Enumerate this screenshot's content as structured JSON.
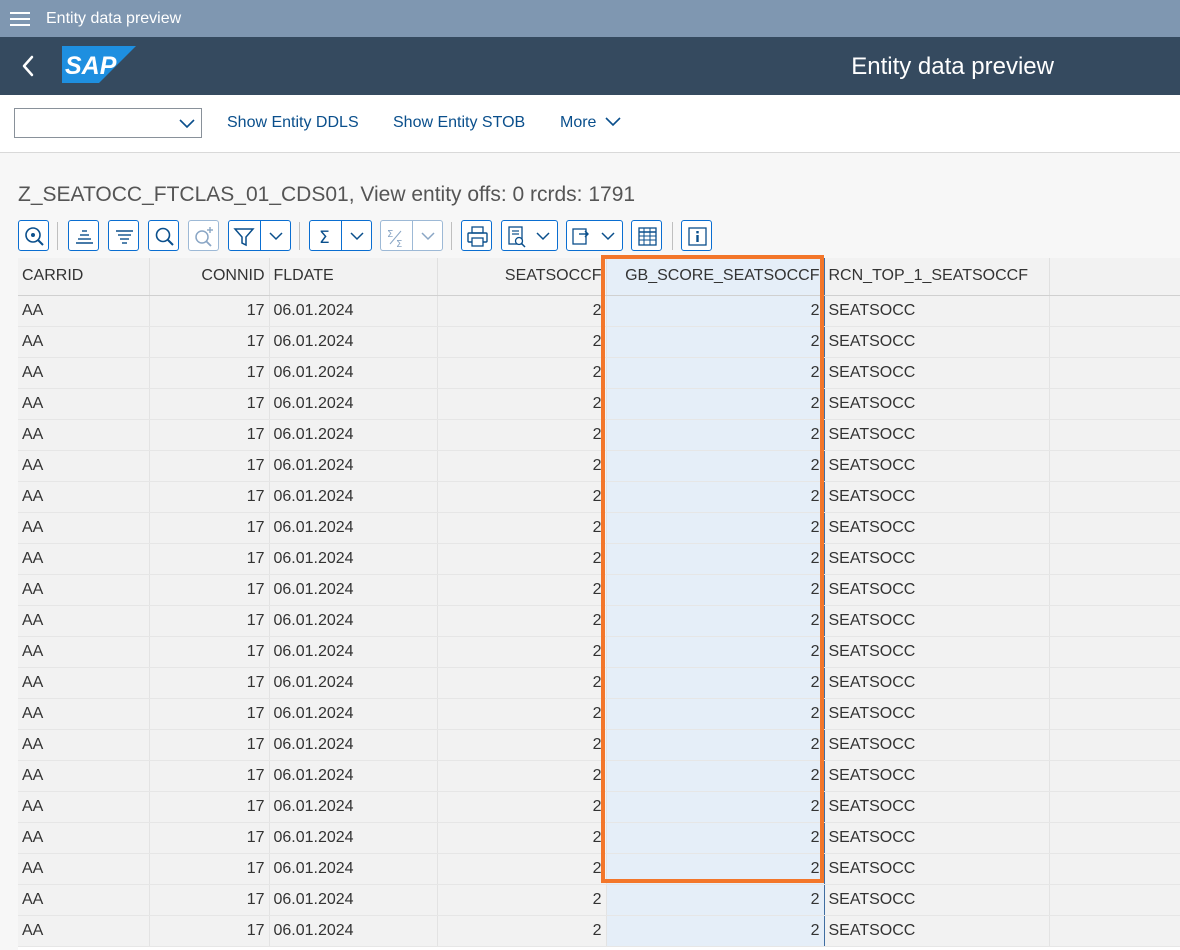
{
  "app_title": "Entity data preview",
  "shell": {
    "title": "Entity data preview",
    "logo_text": "SAP"
  },
  "toolbar": {
    "dropdown_value": "",
    "links": [
      "Show Entity DDLS",
      "Show Entity STOB",
      "More"
    ]
  },
  "entity_title": "Z_SEATOCC_FTCLAS_01_CDS01, View entity offs: 0  rcrds: 1791",
  "grid": {
    "columns": [
      "CARRID",
      "CONNID",
      "FLDATE",
      "SEATSOCCF",
      "GB_SCORE_SEATSOCCF",
      "RCN_TOP_1_SEATSOCCF"
    ],
    "rows": [
      [
        "AA",
        "17",
        "06.01.2024",
        "2",
        "2",
        "SEATSOCC"
      ],
      [
        "AA",
        "17",
        "06.01.2024",
        "2",
        "2",
        "SEATSOCC"
      ],
      [
        "AA",
        "17",
        "06.01.2024",
        "2",
        "2",
        "SEATSOCC"
      ],
      [
        "AA",
        "17",
        "06.01.2024",
        "2",
        "2",
        "SEATSOCC"
      ],
      [
        "AA",
        "17",
        "06.01.2024",
        "2",
        "2",
        "SEATSOCC"
      ],
      [
        "AA",
        "17",
        "06.01.2024",
        "2",
        "2",
        "SEATSOCC"
      ],
      [
        "AA",
        "17",
        "06.01.2024",
        "2",
        "2",
        "SEATSOCC"
      ],
      [
        "AA",
        "17",
        "06.01.2024",
        "2",
        "2",
        "SEATSOCC"
      ],
      [
        "AA",
        "17",
        "06.01.2024",
        "2",
        "2",
        "SEATSOCC"
      ],
      [
        "AA",
        "17",
        "06.01.2024",
        "2",
        "2",
        "SEATSOCC"
      ],
      [
        "AA",
        "17",
        "06.01.2024",
        "2",
        "2",
        "SEATSOCC"
      ],
      [
        "AA",
        "17",
        "06.01.2024",
        "2",
        "2",
        "SEATSOCC"
      ],
      [
        "AA",
        "17",
        "06.01.2024",
        "2",
        "2",
        "SEATSOCC"
      ],
      [
        "AA",
        "17",
        "06.01.2024",
        "2",
        "2",
        "SEATSOCC"
      ],
      [
        "AA",
        "17",
        "06.01.2024",
        "2",
        "2",
        "SEATSOCC"
      ],
      [
        "AA",
        "17",
        "06.01.2024",
        "2",
        "2",
        "SEATSOCC"
      ],
      [
        "AA",
        "17",
        "06.01.2024",
        "2",
        "2",
        "SEATSOCC"
      ],
      [
        "AA",
        "17",
        "06.01.2024",
        "2",
        "2",
        "SEATSOCC"
      ],
      [
        "AA",
        "17",
        "06.01.2024",
        "2",
        "2",
        "SEATSOCC"
      ],
      [
        "AA",
        "17",
        "06.01.2024",
        "2",
        "2",
        "SEATSOCC"
      ],
      [
        "AA",
        "17",
        "06.01.2024",
        "2",
        "2",
        "SEATSOCC"
      ]
    ]
  },
  "colors": {
    "title_bar": "#7f97b1",
    "shell_bar": "#354a5f",
    "link": "#0a4f8c",
    "selected_column": "#e5eef8",
    "highlight_frame": "#f3762a"
  }
}
